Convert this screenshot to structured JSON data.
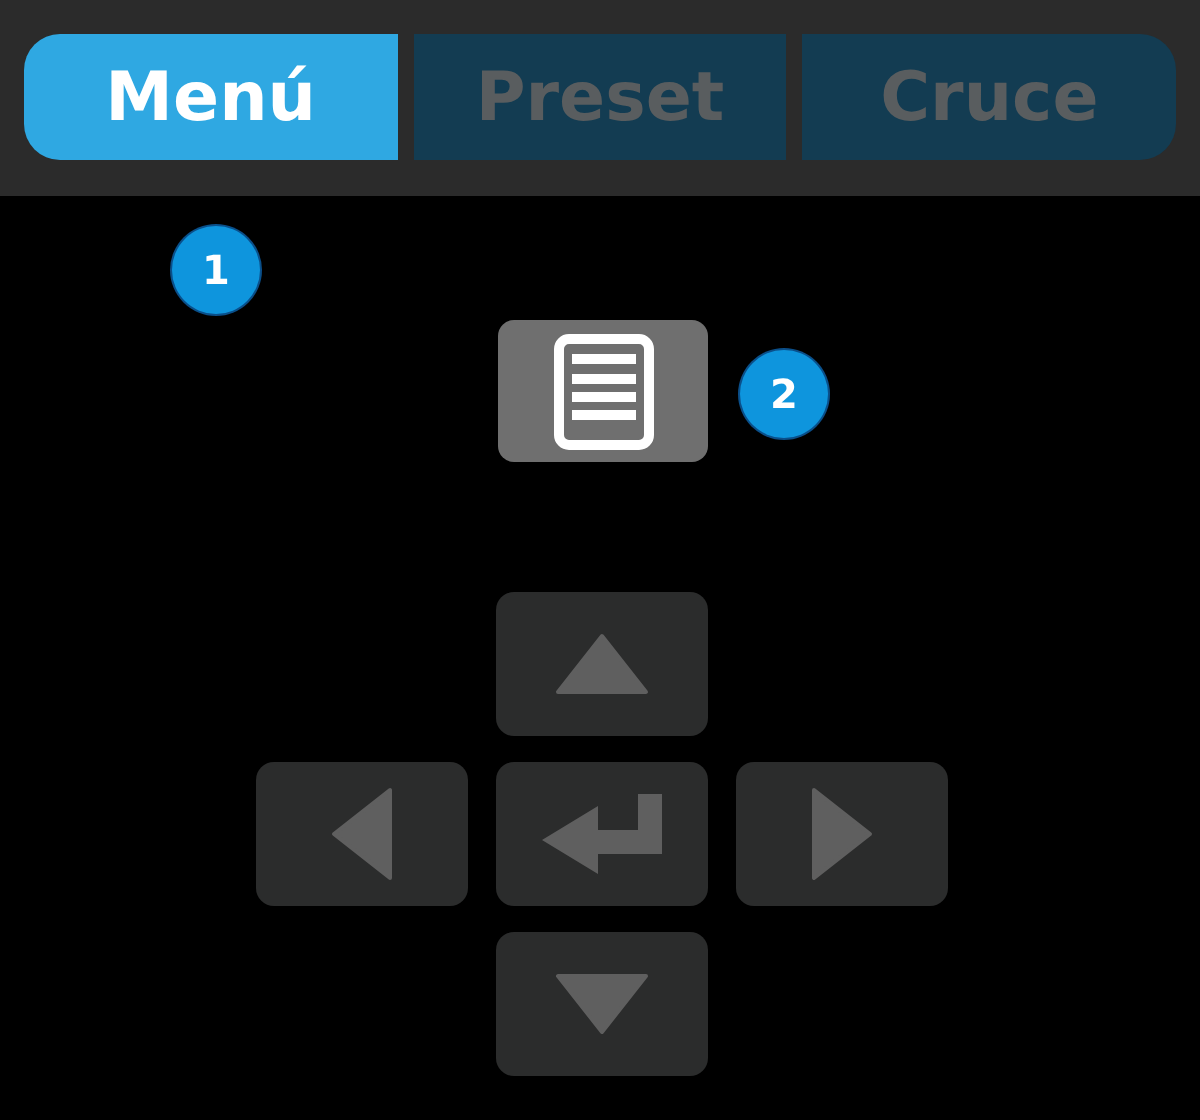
{
  "tabs": [
    {
      "label": "Menú",
      "selected": true
    },
    {
      "label": "Preset",
      "selected": false
    },
    {
      "label": "Cruce",
      "selected": false
    }
  ],
  "callouts": [
    {
      "number": "1",
      "kind": "top"
    },
    {
      "number": "2",
      "kind": "menu"
    }
  ],
  "dpad": [
    {
      "kind": "up"
    },
    {
      "kind": "left"
    },
    {
      "kind": "enter"
    },
    {
      "kind": "right"
    },
    {
      "kind": "down"
    }
  ]
}
